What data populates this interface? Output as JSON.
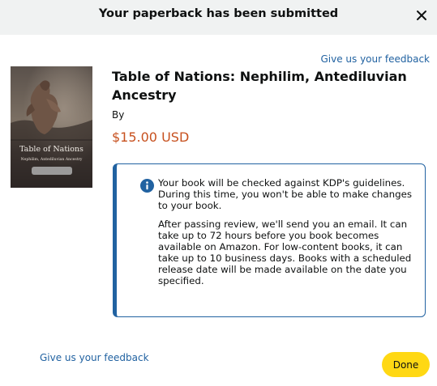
{
  "header": {
    "title": "Your paperback has been submitted",
    "close_icon": "close-icon"
  },
  "feedback_link_top": "Give us your feedback",
  "book": {
    "title": "Table of Nations: Nephilim, Antediluvian Ancestry",
    "by_label": "By",
    "price": "$15.00 USD",
    "cover": {
      "title": "Table of Nations",
      "subtitle": "Nephilim, Antediluvian Ancestry"
    }
  },
  "info_box": {
    "icon": "info-icon",
    "paragraph_1": "Your book will be checked against KDP's guidelines. During this time, you won't be able to make changes to your book.",
    "paragraph_2": "After passing review, we'll send you an email. It can take up to 72 hours before you book becomes available on Amazon. For low-content books, it can take up to 10 business days. Books with a scheduled release date will be made available on the date you specified."
  },
  "footer": {
    "feedback_link": "Give us your feedback",
    "done_label": "Done"
  },
  "colors": {
    "header_bg": "#f0f2f2",
    "link": "#2162a1",
    "price": "#c7511f",
    "done_button": "#ffd814",
    "info_accent": "#2162a1"
  }
}
